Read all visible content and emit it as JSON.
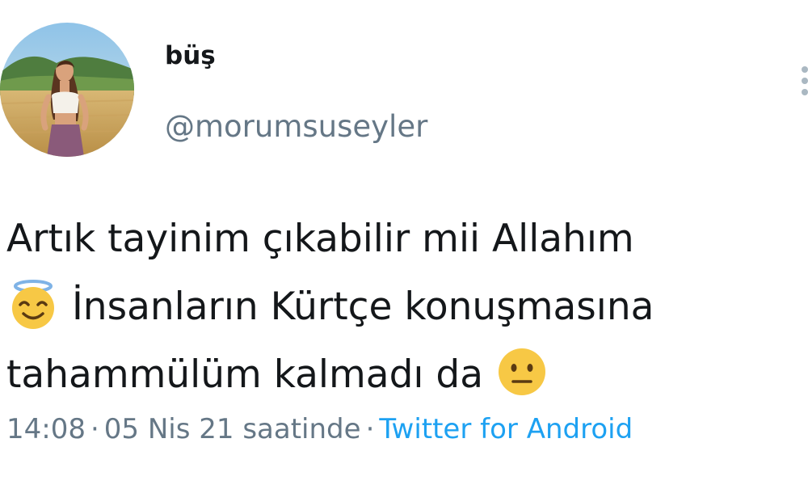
{
  "user": {
    "display_name": "büş",
    "handle": "@morumsuseyler"
  },
  "tweet": {
    "line1": "Artık tayinim çıkabilir mii Allahım",
    "line2": " İnsanların Kürtçe konuşmasına",
    "line3": "tahammülüm kalmadı da ",
    "emoji_angel": "smiling-face-with-halo",
    "emoji_neutral": "neutral-face"
  },
  "meta": {
    "time": "14:08",
    "separator": "·",
    "date": "05 Nis 21 saatinde",
    "source": "Twitter for Android"
  },
  "colors": {
    "text": "#14171a",
    "secondary": "#657786",
    "link": "#1da1f2"
  }
}
